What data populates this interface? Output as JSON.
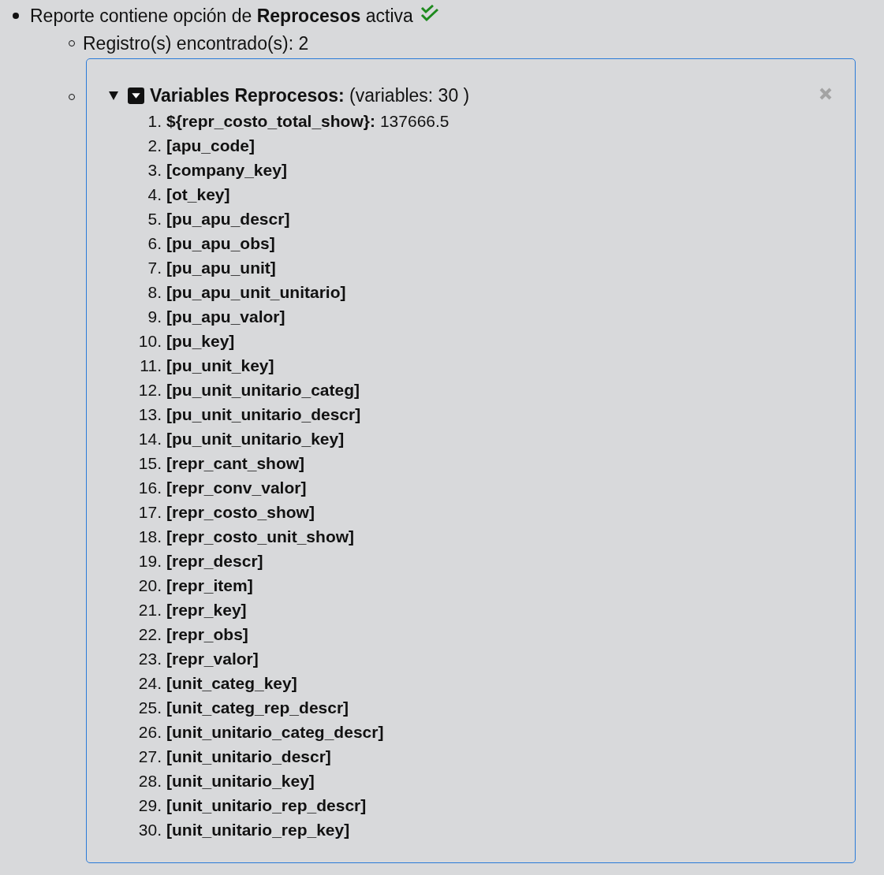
{
  "status": {
    "text_before": "Reporte contiene opción de",
    "emphasis": "Reprocesos",
    "text_after": "activa",
    "ok": true
  },
  "records": {
    "label": "Registro(s) encontrado(s): 2"
  },
  "panel": {
    "expanded": true,
    "title": "Variables Reprocesos:",
    "summary": "(variables: 30 )",
    "items": [
      {
        "number": "1.",
        "name": "${repr_costo_total_show}:",
        "value": "137666.5"
      },
      {
        "number": "2.",
        "name": "[apu_code]"
      },
      {
        "number": "3.",
        "name": "[company_key]"
      },
      {
        "number": "4.",
        "name": "[ot_key]"
      },
      {
        "number": "5.",
        "name": "[pu_apu_descr]"
      },
      {
        "number": "6.",
        "name": "[pu_apu_obs]"
      },
      {
        "number": "7.",
        "name": "[pu_apu_unit]"
      },
      {
        "number": "8.",
        "name": "[pu_apu_unit_unitario]"
      },
      {
        "number": "9.",
        "name": "[pu_apu_valor]"
      },
      {
        "number": "10.",
        "name": "[pu_key]"
      },
      {
        "number": "11.",
        "name": "[pu_unit_key]"
      },
      {
        "number": "12.",
        "name": "[pu_unit_unitario_categ]"
      },
      {
        "number": "13.",
        "name": "[pu_unit_unitario_descr]"
      },
      {
        "number": "14.",
        "name": "[pu_unit_unitario_key]"
      },
      {
        "number": "15.",
        "name": "[repr_cant_show]"
      },
      {
        "number": "16.",
        "name": "[repr_conv_valor]"
      },
      {
        "number": "17.",
        "name": "[repr_costo_show]"
      },
      {
        "number": "18.",
        "name": "[repr_costo_unit_show]"
      },
      {
        "number": "19.",
        "name": "[repr_descr]"
      },
      {
        "number": "20.",
        "name": "[repr_item]"
      },
      {
        "number": "21.",
        "name": "[repr_key]"
      },
      {
        "number": "22.",
        "name": "[repr_obs]"
      },
      {
        "number": "23.",
        "name": "[repr_valor]"
      },
      {
        "number": "24.",
        "name": "[unit_categ_key]"
      },
      {
        "number": "25.",
        "name": "[unit_categ_rep_descr]"
      },
      {
        "number": "26.",
        "name": "[unit_unitario_categ_descr]"
      },
      {
        "number": "27.",
        "name": "[unit_unitario_descr]"
      },
      {
        "number": "28.",
        "name": "[unit_unitario_key]"
      },
      {
        "number": "29.",
        "name": "[unit_unitario_rep_descr]"
      },
      {
        "number": "30.",
        "name": "[unit_unitario_rep_key]"
      }
    ]
  }
}
